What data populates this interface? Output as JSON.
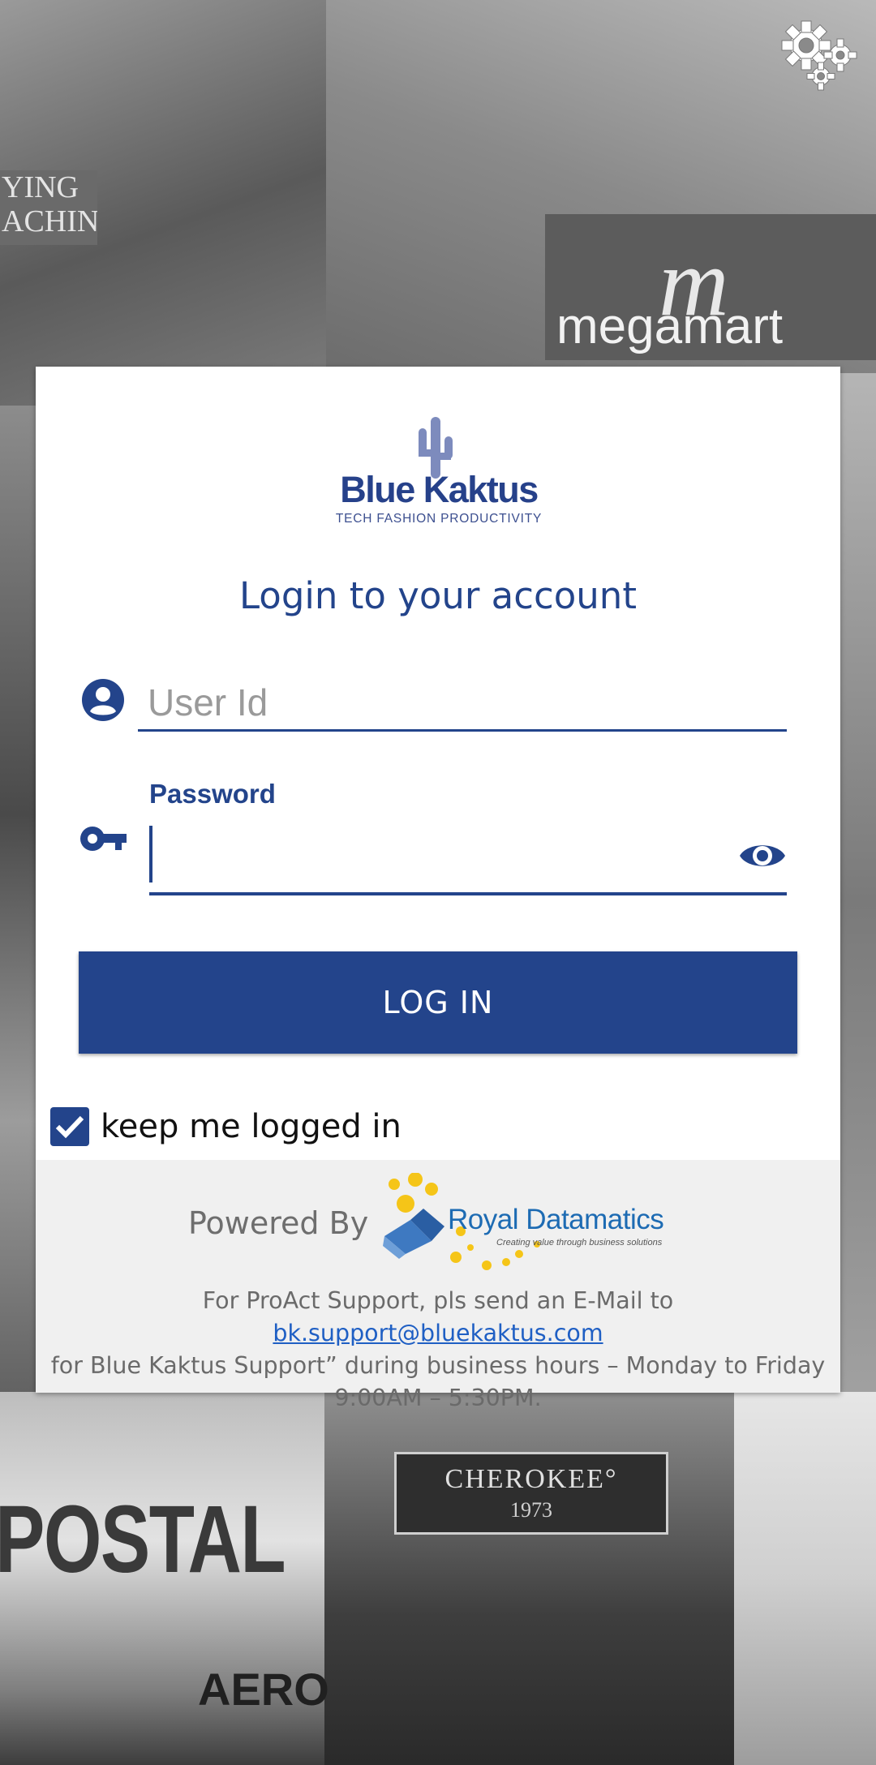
{
  "background": {
    "sign_lying": "YING\nACHINE",
    "sign_megamart": "megamart",
    "sign_cherokee_line1": "CHEROKEE°",
    "sign_cherokee_line2": "1973",
    "sign_postal": "POSTAL",
    "sign_aero": "AERO"
  },
  "settings": {
    "icon": "gears-icon"
  },
  "logo": {
    "brand": "Blue Kaktus",
    "tagline": "TECH FASHION PRODUCTIVITY"
  },
  "form": {
    "title": "Login to your account",
    "userid_placeholder": "User Id",
    "userid_value": "",
    "password_label": "Password",
    "password_value": "",
    "login_label": "LOG IN",
    "keep_logged_in_label": "keep me logged in",
    "keep_logged_in_checked": true
  },
  "footer": {
    "powered_by": "Powered By",
    "partner_name": "Royal Datamatics",
    "partner_tagline": "Creating value through business solutions",
    "support_prefix": "For ProAct Support, pls send an E-Mail to ",
    "support_email": "bk.support@bluekaktus.com",
    "support_line2": "for Blue Kaktus Support” during business hours – Monday to Friday",
    "support_line3": "9:00AM – 5:30PM."
  },
  "colors": {
    "brand": "#23448b",
    "footer_bg": "#f0f0f0",
    "link": "#1f5fc4"
  }
}
